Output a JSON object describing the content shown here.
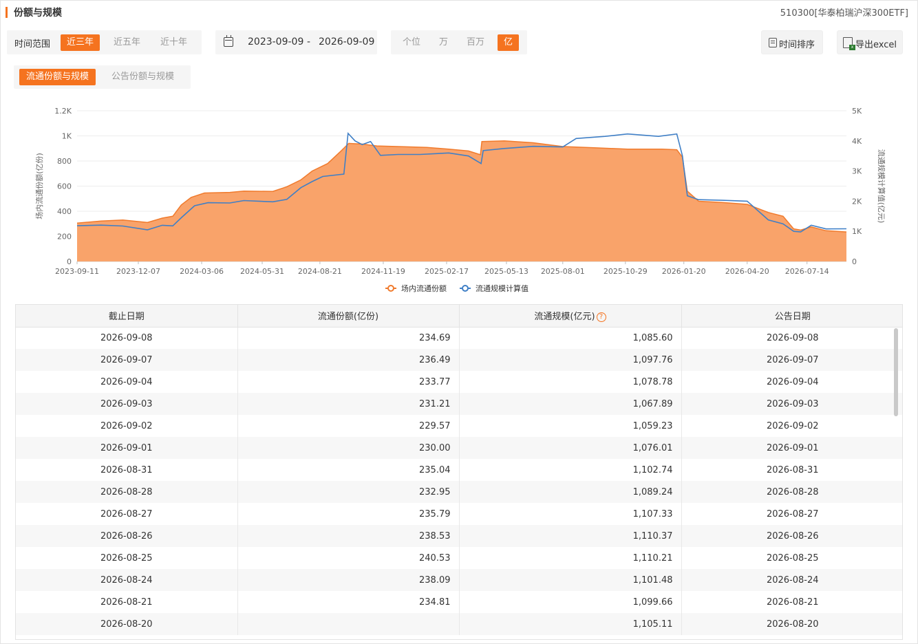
{
  "header": {
    "title": "份额与规模",
    "fund_name": "510300[华泰柏瑞沪深300ETF]"
  },
  "toolbar": {
    "range_label": "时间范围",
    "range_options": [
      "近三年",
      "近五年",
      "近十年"
    ],
    "range_selected": "近三年",
    "date_start": "2023-09-09",
    "date_separator": "-",
    "date_end": "2026-09-09",
    "unit_options": [
      "个位",
      "万",
      "百万",
      "亿"
    ],
    "unit_selected": "亿",
    "sort_label": "时间排序",
    "export_label": "导出excel"
  },
  "tabs": [
    "流通份额与规模",
    "公告份额与规模"
  ],
  "tab_selected": "流通份额与规模",
  "colors": {
    "accent": "#f5731f",
    "area_fill": "#f9a36a",
    "area_line": "#f07a2c",
    "scale_line": "#3f7fc6"
  },
  "chart_data": {
    "type": "area",
    "left_axis": {
      "label": "场内流通份额(亿份)",
      "ticks": [
        "0",
        "200",
        "400",
        "600",
        "800",
        "1K",
        "1.2K"
      ],
      "range": [
        0,
        1200
      ]
    },
    "right_axis": {
      "label": "流通规模计算值(亿元)",
      "ticks": [
        "0",
        "1K",
        "2K",
        "3K",
        "4K",
        "5K"
      ],
      "range": [
        0,
        5000
      ]
    },
    "x_ticks": [
      "2023-09-11",
      "2023-12-07",
      "2024-03-06",
      "2024-05-31",
      "2024-08-21",
      "2024-11-19",
      "2025-02-17",
      "2025-05-13",
      "2025-08-01",
      "2025-10-29",
      "2026-01-20",
      "2026-04-20",
      "2026-07-14"
    ],
    "x_range": [
      "2023-09-11",
      "2026-09-08"
    ],
    "grid": true,
    "legend_position": "bottom",
    "series": [
      {
        "name": "场内流通份额",
        "axis": "left",
        "points": [
          [
            "2023-09-11",
            305
          ],
          [
            "2023-10-15",
            322
          ],
          [
            "2023-11-15",
            330
          ],
          [
            "2023-12-20",
            310
          ],
          [
            "2024-01-10",
            345
          ],
          [
            "2024-01-25",
            360
          ],
          [
            "2024-02-06",
            450
          ],
          [
            "2024-02-20",
            510
          ],
          [
            "2024-03-10",
            545
          ],
          [
            "2024-04-15",
            550
          ],
          [
            "2024-05-05",
            560
          ],
          [
            "2024-06-15",
            558
          ],
          [
            "2024-07-05",
            595
          ],
          [
            "2024-07-25",
            650
          ],
          [
            "2024-08-10",
            720
          ],
          [
            "2024-09-01",
            780
          ],
          [
            "2024-09-20",
            880
          ],
          [
            "2024-10-01",
            940
          ],
          [
            "2024-10-20",
            935
          ],
          [
            "2024-11-10",
            920
          ],
          [
            "2024-12-10",
            915
          ],
          [
            "2025-01-20",
            908
          ],
          [
            "2025-02-20",
            895
          ],
          [
            "2025-03-20",
            880
          ],
          [
            "2025-04-06",
            850
          ],
          [
            "2025-04-08",
            955
          ],
          [
            "2025-05-10",
            960
          ],
          [
            "2025-06-20",
            945
          ],
          [
            "2025-08-01",
            915
          ],
          [
            "2025-09-15",
            905
          ],
          [
            "2025-11-01",
            895
          ],
          [
            "2025-12-20",
            895
          ],
          [
            "2026-01-10",
            890
          ],
          [
            "2026-01-18",
            830
          ],
          [
            "2026-01-25",
            560
          ],
          [
            "2026-02-10",
            480
          ],
          [
            "2026-03-15",
            470
          ],
          [
            "2026-04-20",
            455
          ],
          [
            "2026-05-20",
            390
          ],
          [
            "2026-06-10",
            360
          ],
          [
            "2026-06-25",
            260
          ],
          [
            "2026-07-05",
            250
          ],
          [
            "2026-07-20",
            275
          ],
          [
            "2026-08-10",
            245
          ],
          [
            "2026-09-08",
            235
          ]
        ]
      },
      {
        "name": "流通规模计算值",
        "axis": "right",
        "points": [
          [
            "2023-09-11",
            1185
          ],
          [
            "2023-10-15",
            1205
          ],
          [
            "2023-11-15",
            1175
          ],
          [
            "2023-12-20",
            1050
          ],
          [
            "2024-01-10",
            1200
          ],
          [
            "2024-01-25",
            1180
          ],
          [
            "2024-02-06",
            1450
          ],
          [
            "2024-02-25",
            1850
          ],
          [
            "2024-03-15",
            1950
          ],
          [
            "2024-04-15",
            1940
          ],
          [
            "2024-05-05",
            2020
          ],
          [
            "2024-06-15",
            1980
          ],
          [
            "2024-07-05",
            2060
          ],
          [
            "2024-07-25",
            2450
          ],
          [
            "2024-08-10",
            2650
          ],
          [
            "2024-08-25",
            2820
          ],
          [
            "2024-09-24",
            2900
          ],
          [
            "2024-09-30",
            4250
          ],
          [
            "2024-10-10",
            4000
          ],
          [
            "2024-10-20",
            3880
          ],
          [
            "2024-11-01",
            3980
          ],
          [
            "2024-11-15",
            3520
          ],
          [
            "2024-12-10",
            3550
          ],
          [
            "2025-01-10",
            3550
          ],
          [
            "2025-02-20",
            3600
          ],
          [
            "2025-03-20",
            3500
          ],
          [
            "2025-04-07",
            3250
          ],
          [
            "2025-04-10",
            3680
          ],
          [
            "2025-05-10",
            3750
          ],
          [
            "2025-06-20",
            3820
          ],
          [
            "2025-08-01",
            3800
          ],
          [
            "2025-08-20",
            4080
          ],
          [
            "2025-09-30",
            4150
          ],
          [
            "2025-11-01",
            4230
          ],
          [
            "2025-12-15",
            4150
          ],
          [
            "2026-01-10",
            4230
          ],
          [
            "2026-01-18",
            3500
          ],
          [
            "2026-01-25",
            2180
          ],
          [
            "2026-02-10",
            2050
          ],
          [
            "2026-03-15",
            2030
          ],
          [
            "2026-04-20",
            2000
          ],
          [
            "2026-05-20",
            1380
          ],
          [
            "2026-06-10",
            1250
          ],
          [
            "2026-06-25",
            1000
          ],
          [
            "2026-07-05",
            980
          ],
          [
            "2026-07-20",
            1200
          ],
          [
            "2026-08-10",
            1080
          ],
          [
            "2026-09-08",
            1085
          ]
        ]
      }
    ]
  },
  "table": {
    "columns": [
      "截止日期",
      "流通份额(亿份)",
      "流通规模(亿元)",
      "公告日期"
    ],
    "rows": [
      [
        "2026-09-08",
        "234.69",
        "1,085.60",
        "2026-09-08"
      ],
      [
        "2026-09-07",
        "236.49",
        "1,097.76",
        "2026-09-07"
      ],
      [
        "2026-09-04",
        "233.77",
        "1,078.78",
        "2026-09-04"
      ],
      [
        "2026-09-03",
        "231.21",
        "1,067.89",
        "2026-09-03"
      ],
      [
        "2026-09-02",
        "229.57",
        "1,059.23",
        "2026-09-02"
      ],
      [
        "2026-09-01",
        "230.00",
        "1,076.01",
        "2026-09-01"
      ],
      [
        "2026-08-31",
        "235.04",
        "1,102.74",
        "2026-08-31"
      ],
      [
        "2026-08-28",
        "232.95",
        "1,089.24",
        "2026-08-28"
      ],
      [
        "2026-08-27",
        "235.79",
        "1,107.33",
        "2026-08-27"
      ],
      [
        "2026-08-26",
        "238.53",
        "1,110.37",
        "2026-08-26"
      ],
      [
        "2026-08-25",
        "240.53",
        "1,110.21",
        "2026-08-25"
      ],
      [
        "2026-08-24",
        "238.09",
        "1,101.48",
        "2026-08-24"
      ],
      [
        "2026-08-21",
        "234.81",
        "1,099.66",
        "2026-08-21"
      ],
      [
        "2026-08-20",
        "",
        "1,105.11",
        "2026-08-20"
      ]
    ]
  }
}
